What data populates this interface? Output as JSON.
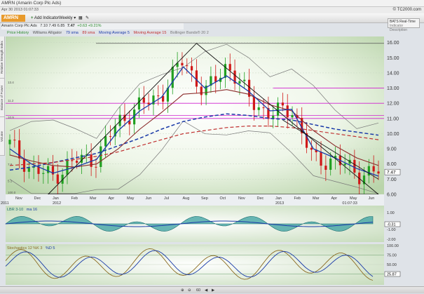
{
  "window": {
    "title": "AMRN (Amarin Corp Plc Ads)",
    "timestamp": "Apr 30 2013 01:07:33",
    "brand": "© TC2000.com"
  },
  "toolbar": {
    "symbol": "AMRN",
    "add_indicator": "Add Indicator",
    "period": "Weekly",
    "icons": [
      "plus-icon",
      "chevron-down-icon",
      "grid-icon",
      "pencil-icon"
    ]
  },
  "price_line": {
    "company": "Amarin Corp Plc Ads",
    "ohlc": "7.10  7.49  6.85",
    "last": "7.47",
    "change": "+0.63  +9.21%"
  },
  "realtime": {
    "line1": "BATS Real-Time",
    "line2": "Indicator Description"
  },
  "legend": {
    "price_history": "Price History",
    "alligator": "Williams Alligator",
    "sma79": "79 sma",
    "sma89": "89 sma",
    "ma5": "Moving Average 5",
    "ma15": "Moving Average 15",
    "bollinger": "Bollinger Bands® 20 2",
    "colors": {
      "price_history": "#2a8a2a",
      "alligator": "#555555",
      "sma79": "#1a3aa8",
      "sma89": "#c03030",
      "ma5": "#1a3aa8",
      "ma15": "#c03030",
      "bollinger": "#777777"
    }
  },
  "left_tabs": [
    "Relative Strength Index",
    "Balance of Power",
    "Volume"
  ],
  "price_axis": [
    "16.00",
    "15.00",
    "14.00",
    "13.00",
    "12.00",
    "11.00",
    "10.00",
    "9.00",
    "8.00",
    "7.00",
    "6.00"
  ],
  "price_tag": "7.47",
  "inline_labels": {
    "l1": "13.4",
    "l2": "11.2",
    "l3": "10.9",
    "l4": "7.8",
    "l5": "5.1",
    "l6": "100.0"
  },
  "time_axis": [
    "Nov",
    "Dec",
    "Jan",
    "Feb",
    "Mar",
    "Apr",
    "May",
    "Jun",
    "Jul",
    "Aug",
    "Sep",
    "Oct",
    "Nov",
    "Dec",
    "Jan",
    "Feb",
    "Mar",
    "Apr",
    "May",
    "Jun"
  ],
  "years": {
    "y2011": "2011",
    "y2012": "2012",
    "y2013": "2013"
  },
  "time_readout": "01:07:33",
  "lbr": {
    "label": "LBR 3-10",
    "ma_label": "ma 16",
    "axis": [
      "1.00",
      "-1.00",
      "-2.00"
    ],
    "tag": "-0.31"
  },
  "stoch": {
    "label": "Stochastics 12 %K 3",
    "d_label": "%D 5",
    "axis": [
      "100.00",
      "75.00",
      "50.00",
      "25.00"
    ],
    "tag": "25.87"
  },
  "bottom": {
    "zoom_label": "60",
    "icons": [
      "zoom-in-icon",
      "zoom-out-icon",
      "scroll-left-icon",
      "scroll-right-icon"
    ]
  },
  "chart_data": {
    "type": "candlestick",
    "title": "AMRN (Amarin Corp Plc Ads)",
    "xlabel": "",
    "ylabel": "",
    "ylim": [
      6,
      16
    ],
    "x": [
      "2011-11",
      "2011-12",
      "2012-01",
      "2012-02",
      "2012-03",
      "2012-04",
      "2012-05",
      "2012-06",
      "2012-07",
      "2012-08",
      "2012-09",
      "2012-10",
      "2012-11",
      "2012-12",
      "2013-01",
      "2013-02",
      "2013-03",
      "2013-04"
    ],
    "series": [
      {
        "name": "Price History",
        "values": [
          9.3,
          7.6,
          7.2,
          8.2,
          8.4,
          10.8,
          11.8,
          12.6,
          14.9,
          12.6,
          14.6,
          12.4,
          11.2,
          11.7,
          8.2,
          8.3,
          7.4,
          7.47
        ]
      },
      {
        "name": "Moving Average 5",
        "values": [
          9.0,
          8.0,
          7.4,
          7.8,
          8.3,
          10.2,
          11.5,
          12.4,
          14.4,
          13.0,
          13.8,
          12.8,
          11.5,
          11.6,
          9.0,
          8.4,
          7.7,
          7.2
        ]
      },
      {
        "name": "Moving Average 15",
        "values": [
          8.6,
          8.2,
          7.9,
          7.8,
          8.0,
          9.0,
          10.3,
          11.4,
          12.6,
          12.7,
          12.9,
          12.6,
          11.9,
          11.5,
          10.2,
          9.2,
          8.4,
          7.9
        ]
      },
      {
        "name": "79 sma",
        "values": [
          7.6,
          7.8,
          8.1,
          8.4,
          8.7,
          9.2,
          9.7,
          10.3,
          10.8,
          11.1,
          11.3,
          11.2,
          11.0,
          10.9,
          10.6,
          10.3,
          10.1,
          9.9
        ]
      },
      {
        "name": "89 sma",
        "values": [
          7.9,
          8.0,
          8.1,
          8.3,
          8.5,
          8.8,
          9.2,
          9.6,
          10.0,
          10.2,
          10.4,
          10.5,
          10.5,
          10.4,
          10.2,
          10.0,
          9.8,
          9.6
        ]
      }
    ],
    "horizontal_lines": [
      15.95,
      13.0,
      12.0,
      11.2,
      11.0
    ],
    "grid": true,
    "legend": "top-left"
  }
}
